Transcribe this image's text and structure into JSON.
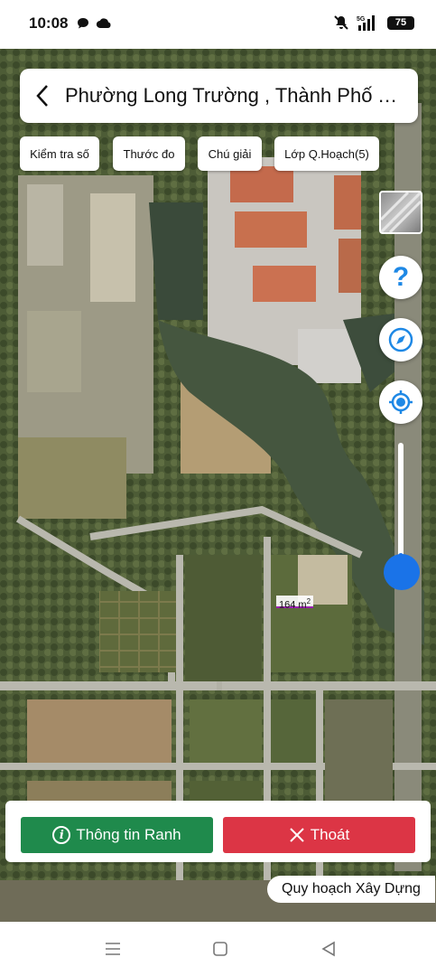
{
  "status_bar": {
    "time": "10:08",
    "network": "5G",
    "battery": "75",
    "icons": [
      "chat-bubble-icon",
      "cloud-icon",
      "mute-bell-icon",
      "signal-icon"
    ]
  },
  "header": {
    "title": "Phường Long Trường , Thành Phố Thủ Đức",
    "back_icon": "chevron-left-icon"
  },
  "toolbar": {
    "check_number": "Kiểm tra số",
    "ruler": "Thước đo",
    "legend": "Chú giải",
    "planning_layer": "Lớp Q.Hoạch(5)"
  },
  "map": {
    "parcel_area_value": "164 m",
    "parcel_area_sup": "2",
    "zoom_level": 0.1,
    "colors": {
      "parcel_border": "#9b1fb0",
      "accent": "#1a73e8"
    }
  },
  "controls": {
    "help_label": "?",
    "icons": [
      "layer-thumbnail-icon",
      "help-icon",
      "compass-icon",
      "my-location-icon"
    ]
  },
  "actions": {
    "info_label": "Thông tin Ranh",
    "info_icon_glyph": "i",
    "exit_label": "Thoát",
    "colors": {
      "info": "#1f8a4c",
      "exit": "#dc3545"
    }
  },
  "map_caption": "Quy hoạch Xây Dựng",
  "nav_bar": {
    "icons": [
      "menu-icon",
      "home-icon",
      "back-icon"
    ]
  }
}
